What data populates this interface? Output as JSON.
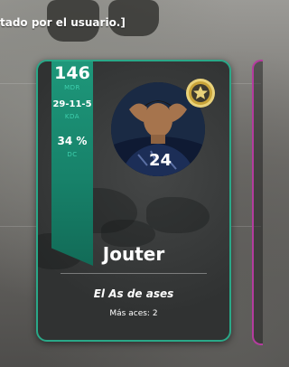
{
  "overlay": {
    "text": "tado por el usuario.]"
  },
  "card": {
    "stats": [
      {
        "value": "146",
        "label": "MDR"
      },
      {
        "value": "29-11-5",
        "label": "KDA"
      },
      {
        "value": "34 %",
        "label": "DC"
      }
    ],
    "jersey_number": "24",
    "name": "Jouter",
    "title": "El As de ases",
    "count_label": "Más aces:",
    "count_value": "2"
  },
  "colors": {
    "accent": "#2aa888",
    "stat_panel": "#17826a",
    "neighbor_card_border": "#b43c9e",
    "badge_gold": "#c9a43a"
  },
  "icons": {
    "badge": "gold-star-medal-icon"
  }
}
